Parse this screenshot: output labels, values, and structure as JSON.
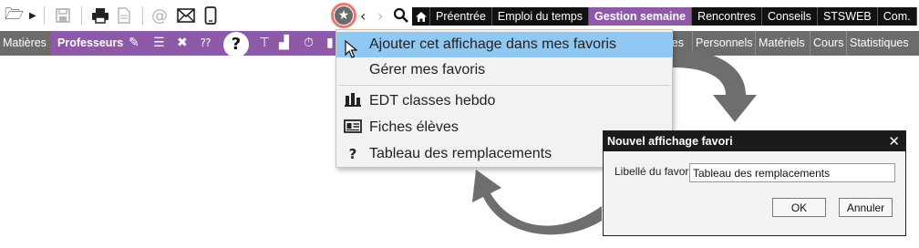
{
  "toolbar": {
    "icons": [
      "folder-open-icon",
      "play-arrow-icon",
      "save-icon",
      "print-icon",
      "document-icon",
      "at-sign-icon",
      "envelope-icon",
      "mobile-phone-icon",
      "favorites-star-icon",
      "chevron-left-icon",
      "chevron-right-icon",
      "search-icon",
      "home-icon"
    ]
  },
  "main_tabs": [
    "Préentrée",
    "Emploi du temps",
    "Gestion semaine",
    "Rencontres",
    "Conseils",
    "STSWEB",
    "Com."
  ],
  "active_main_tab": "Gestion semaine",
  "subbar": {
    "left_item": "Matières",
    "active_item": "Professeurs",
    "right_items": [
      "Personnels",
      "Matériels",
      "Cours",
      "Statistiques"
    ],
    "partial_text": "les"
  },
  "favorites_menu": {
    "items": [
      {
        "label": "Ajouter cet affichage dans mes favoris",
        "icon": "",
        "highlighted": true
      },
      {
        "label": "Gérer mes favoris",
        "icon": "",
        "highlighted": false
      },
      {
        "label": "EDT classes hebdo",
        "icon": "timetable-classes-icon",
        "highlighted": false
      },
      {
        "label": "Fiches élèves",
        "icon": "student-card-icon",
        "highlighted": false
      },
      {
        "label": "Tableau des remplacements",
        "icon": "question-mark-icon",
        "highlighted": false
      }
    ]
  },
  "dialog": {
    "title": "Nouvel affichage favori",
    "close_glyph": "✕",
    "field_label": "Libellé du favori",
    "field_value": "Tableau des remplacements",
    "ok_label": "OK",
    "cancel_label": "Annuler"
  },
  "colors": {
    "accent_purple": "#8e5aa8",
    "menu_highlight": "#90c8f4",
    "favorite_ring": "#e7786f",
    "subbar_gray": "#6c6c6c",
    "arrow_gray": "#6e6e6e"
  }
}
